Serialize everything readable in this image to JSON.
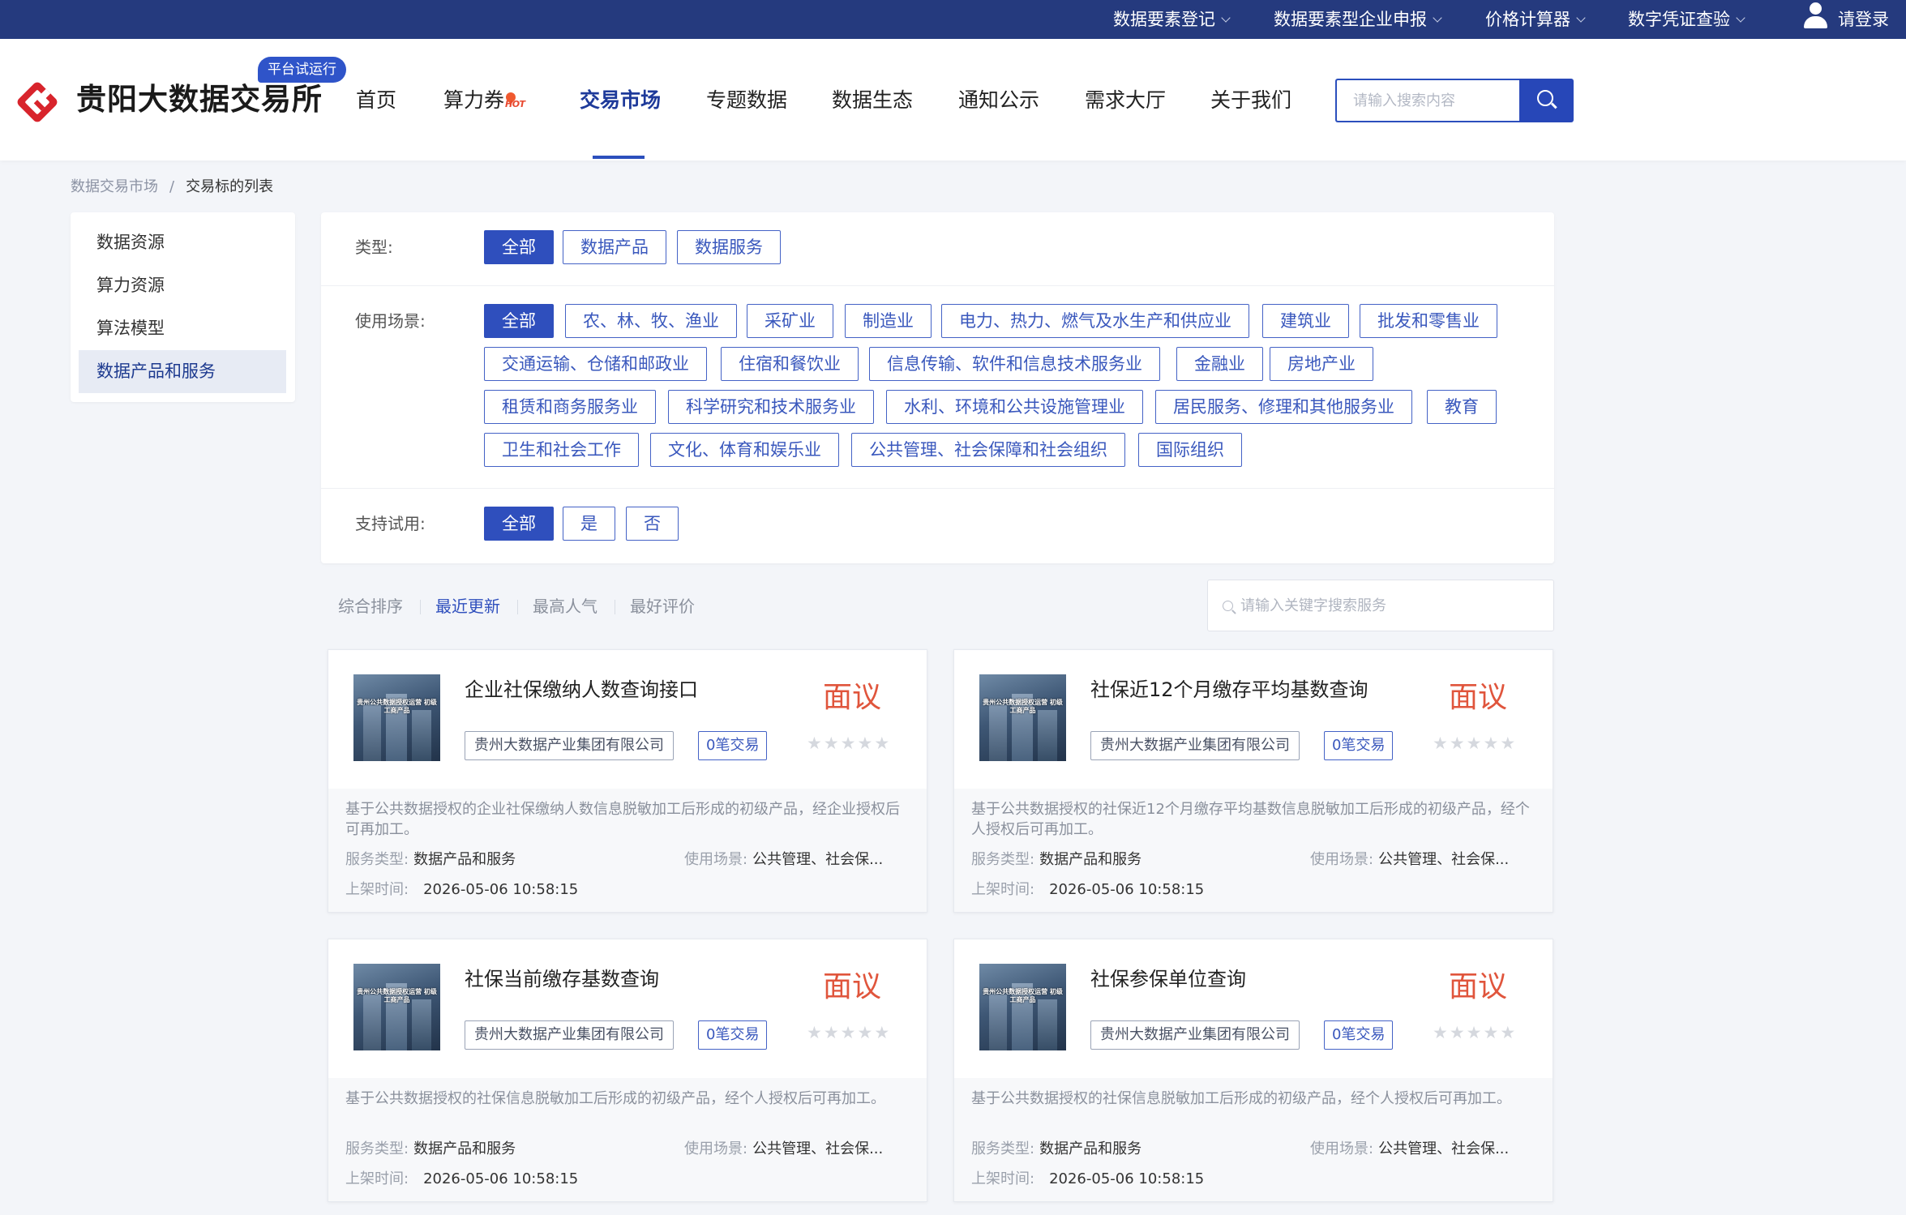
{
  "topbar": {
    "items": [
      {
        "label": "数据要素登记"
      },
      {
        "label": "数据要素型企业申报"
      },
      {
        "label": "价格计算器"
      },
      {
        "label": "数字凭证查验"
      }
    ],
    "login_label": "请登录"
  },
  "header": {
    "logo_text": "贵阳大数据交易所",
    "trial_badge": "平台试运行",
    "nav": [
      {
        "label": "首页"
      },
      {
        "label": "算力券"
      },
      {
        "label": "交易市场",
        "active": true
      },
      {
        "label": "专题数据"
      },
      {
        "label": "数据生态"
      },
      {
        "label": "通知公示"
      },
      {
        "label": "需求大厅"
      },
      {
        "label": "关于我们"
      }
    ],
    "hot_tag": "HOT",
    "search_placeholder": "请输入搜索内容"
  },
  "breadcrumb": {
    "root": "数据交易市场",
    "separator": "/",
    "current": "交易标的列表"
  },
  "sidebar": {
    "items": [
      {
        "label": "数据资源"
      },
      {
        "label": "算力资源"
      },
      {
        "label": "算法模型"
      },
      {
        "label": "数据产品和服务",
        "active": true
      }
    ]
  },
  "filters": {
    "type": {
      "label": "类型:",
      "options": [
        "全部",
        "数据产品",
        "数据服务"
      ],
      "selected": "全部"
    },
    "scene": {
      "label": "使用场景:",
      "options": [
        "全部",
        "农、林、牧、渔业",
        "采矿业",
        "制造业",
        "电力、热力、燃气及水生产和供应业",
        "建筑业",
        "批发和零售业",
        "交通运输、仓储和邮政业",
        "住宿和餐饮业",
        "信息传输、软件和信息技术服务业",
        "金融业",
        "房地产业",
        "租赁和商务服务业",
        "科学研究和技术服务业",
        "水利、环境和公共设施管理业",
        "居民服务、修理和其他服务业",
        "教育",
        "卫生和社会工作",
        "文化、体育和娱乐业",
        "公共管理、社会保障和社会组织",
        "国际组织"
      ],
      "selected": "全部"
    },
    "trial": {
      "label": "支持试用:",
      "options": [
        "全部",
        "是",
        "否"
      ],
      "selected": "全部"
    }
  },
  "sort": {
    "items": [
      {
        "label": "综合排序"
      },
      {
        "label": "最近更新",
        "active": true
      },
      {
        "label": "最高人气"
      },
      {
        "label": "最好评价"
      }
    ],
    "search_placeholder": "请输入关键字搜索服务"
  },
  "products": [
    {
      "title": "企业社保缴纳人数查询接口",
      "thumb_text": "贵州公共数据授权运营 初级工商产品",
      "org": "贵州大数据产业集团有限公司",
      "deals": "0笔交易",
      "price": "面议",
      "rating": 0,
      "desc": "基于公共数据授权的企业社保缴纳人数信息脱敏加工后形成的初级产品，经企业授权后可再加工。",
      "service_type_label": "服务类型:",
      "service_type": "数据产品和服务",
      "scene_label": "使用场景:",
      "scene": "公共管理、社会保...",
      "time_label": "上架时间:",
      "time": "2026-05-06 10:58:15"
    },
    {
      "title": "社保近12个月缴存平均基数查询",
      "thumb_text": "贵州公共数据授权运营 初级工商产品",
      "org": "贵州大数据产业集团有限公司",
      "deals": "0笔交易",
      "price": "面议",
      "rating": 0,
      "desc": "基于公共数据授权的社保近12个月缴存平均基数信息脱敏加工后形成的初级产品，经个人授权后可再加工。",
      "service_type_label": "服务类型:",
      "service_type": "数据产品和服务",
      "scene_label": "使用场景:",
      "scene": "公共管理、社会保...",
      "time_label": "上架时间:",
      "time": "2026-05-06 10:58:15"
    },
    {
      "title": "社保当前缴存基数查询",
      "thumb_text": "贵州公共数据授权运营 初级工商产品",
      "org": "贵州大数据产业集团有限公司",
      "deals": "0笔交易",
      "price": "面议",
      "rating": 0,
      "desc": "基于公共数据授权的社保信息脱敏加工后形成的初级产品，经个人授权后可再加工。",
      "service_type_label": "服务类型:",
      "service_type": "数据产品和服务",
      "scene_label": "使用场景:",
      "scene": "公共管理、社会保...",
      "time_label": "上架时间:",
      "time": "2026-05-06 10:58:15"
    },
    {
      "title": "社保参保单位查询",
      "thumb_text": "贵州公共数据授权运营 初级工商产品",
      "org": "贵州大数据产业集团有限公司",
      "deals": "0笔交易",
      "price": "面议",
      "rating": 0,
      "desc": "基于公共数据授权的社保信息脱敏加工后形成的初级产品，经个人授权后可再加工。",
      "service_type_label": "服务类型:",
      "service_type": "数据产品和服务",
      "scene_label": "使用场景:",
      "scene": "公共管理、社会保...",
      "time_label": "上架时间:",
      "time": "2026-05-06 10:58:15"
    }
  ],
  "colors": {
    "topbar_bg": "#253a7e",
    "primary": "#2f4fbd",
    "price": "#e0553c",
    "logo_red": "#d8242c"
  }
}
